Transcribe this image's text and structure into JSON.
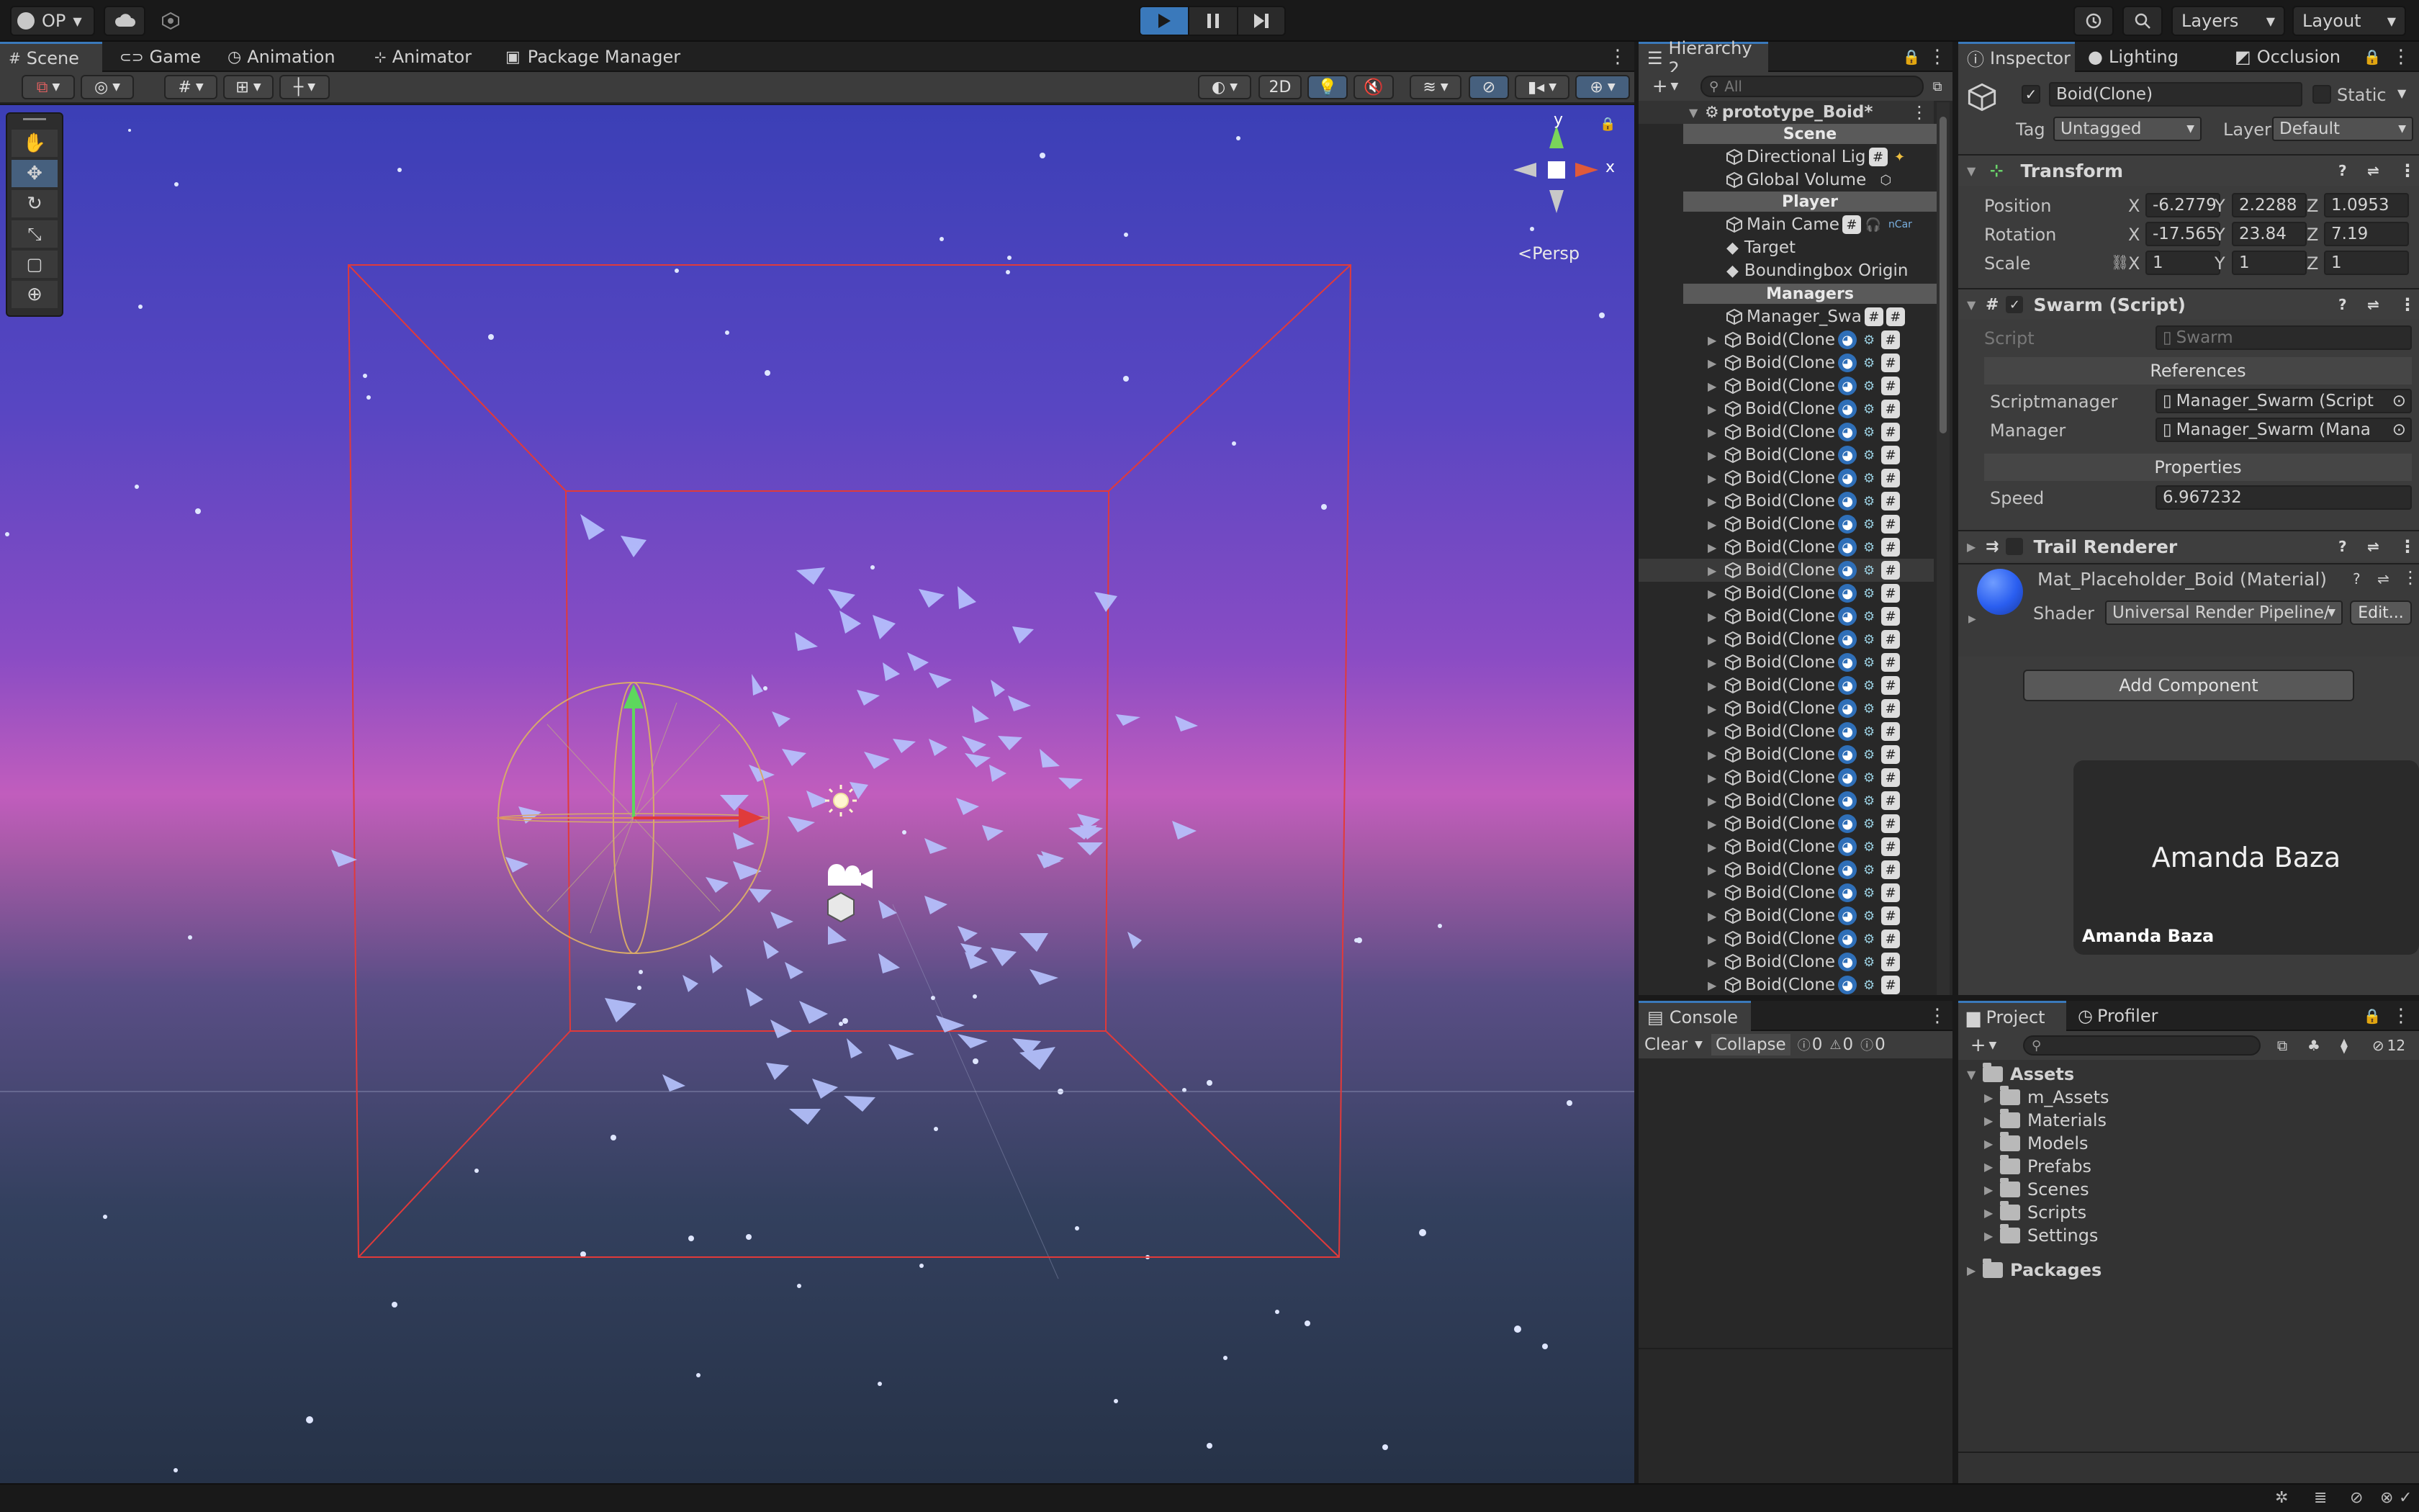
{
  "toolbar": {
    "account": "OP",
    "layers": "Layers",
    "layout": "Layout"
  },
  "scene_tabs": [
    "Scene",
    "Game",
    "Animation",
    "Animator",
    "Package Manager"
  ],
  "scene_view": {
    "mode_2d": "2D",
    "gizmo_y": "y",
    "gizmo_x": "x",
    "persp": "Persp"
  },
  "hierarchy": {
    "tab": "Hierarchy 2",
    "search_placeholder": "All",
    "root": "prototype_Boid*",
    "headers": {
      "scene": "Scene",
      "player": "Player",
      "managers": "Managers"
    },
    "items": {
      "directional_light": "Directional Lig",
      "global_volume": "Global Volume",
      "main_camera": "Main Came",
      "main_camera_tag": "nCar",
      "target": "Target",
      "boundingbox": "Boundingbox Origin",
      "manager": "Manager_Swa"
    },
    "boid_label": "Boid(Clone",
    "boids": [
      "Boid(Clone",
      "Boid(Clone",
      "Boid(Clone",
      "Boid(Clone",
      "Boid(Clone",
      "Boid(Clone",
      "Boid(Clone",
      "Boid(Clone",
      "Boid(Clone",
      "Boid(Clone",
      "Boid(Clone",
      "Boid(Clone",
      "Boid(Clone",
      "Boid(Clone",
      "Boid(Clone",
      "Boid(Clone",
      "Boid(Clone",
      "Boid(Clone",
      "Boid(Clone",
      "Boid(Clone",
      "Boid(Clone",
      "Boid(Clone",
      "Boid(Clone",
      "Boid(Clone",
      "Boid(Clone",
      "Boid(Clone",
      "Boid(Clone",
      "Boid(Clone",
      "Boid(Clone"
    ]
  },
  "inspector": {
    "tabs": [
      "Inspector",
      "Lighting",
      "Occlusion"
    ],
    "object_name": "Boid(Clone)",
    "static": "Static",
    "tag_label": "Tag",
    "tag_value": "Untagged",
    "layer_label": "Layer",
    "layer_value": "Default",
    "transform": {
      "title": "Transform",
      "position_label": "Position",
      "rotation_label": "Rotation",
      "scale_label": "Scale",
      "axes": [
        "X",
        "Y",
        "Z"
      ],
      "position": [
        "-6.2779",
        "2.2288",
        "1.0953"
      ],
      "rotation": [
        "-17.565",
        "23.84",
        "7.19"
      ],
      "scale": [
        "1",
        "1",
        "1"
      ]
    },
    "swarm": {
      "title": "Swarm (Script)",
      "script_label": "Script",
      "script_value": "Swarm",
      "references": "References",
      "scriptmanager_label": "Scriptmanager",
      "scriptmanager_value": "Manager_Swarm (Script",
      "manager_label": "Manager",
      "manager_value": "Manager_Swarm (Mana",
      "properties": "Properties",
      "speed_label": "Speed",
      "speed_value": "6.967232"
    },
    "trail": {
      "title": "Trail Renderer"
    },
    "material": {
      "name": "Mat_Placeholder_Boid (Material)",
      "shader_label": "Shader",
      "shader_value": "Universal Render Pipeline/",
      "edit": "Edit..."
    },
    "add_component": "Add Component",
    "overlay_name": "Amanda Baza",
    "overlay_caption": "Amanda Baza"
  },
  "console": {
    "tab": "Console",
    "clear": "Clear",
    "collapse": "Collapse",
    "counts": [
      "0",
      "0",
      "0"
    ]
  },
  "project": {
    "tabs": [
      "Project",
      "Profiler"
    ],
    "hidden_count": "12",
    "assets": "Assets",
    "folders": [
      "m_Assets",
      "Materials",
      "Models",
      "Prefabs",
      "Scenes",
      "Scripts",
      "Settings"
    ],
    "packages": "Packages"
  }
}
